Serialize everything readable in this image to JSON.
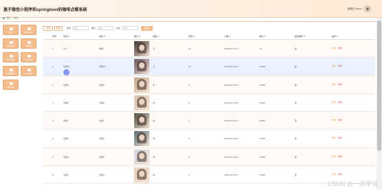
{
  "app": {
    "title": "基于微信小程序和springboot的咖啡点餐系统",
    "user_label": "管理员 admin"
  },
  "breadcrumb": {
    "items": [
      "首页",
      "咖啡"
    ]
  },
  "sidebar": {
    "items": [
      {
        "label": "首页"
      },
      {
        "label": "咖啡分类"
      },
      {
        "label": "咖啡管理"
      },
      {
        "label": "订单管理"
      },
      {
        "label": "用户管理"
      },
      {
        "label": "公告信息"
      },
      {
        "label": "轮播图管理"
      },
      {
        "label": "评论管理"
      },
      {
        "label": "系统管理"
      }
    ]
  },
  "toolbar": {
    "add_label": "+ 新增",
    "delete_label": "删除",
    "search_label": "查询"
  },
  "filters": [
    {
      "label": "名称",
      "placeholder": "名称"
    },
    {
      "label": "类别",
      "placeholder": "类别"
    },
    {
      "label": "价格",
      "placeholder": "价格"
    }
  ],
  "table": {
    "headers": [
      "序号",
      "名称 ⇕",
      "类别 ⇕",
      "图片 ⇕",
      "规格 ⇕",
      "库存 ⇕",
      "日期 ⇕",
      "单价 ⇕",
      "是否推荐 ⇕",
      "操作 ⇕"
    ],
    "rows": [
      {
        "index": "1",
        "name": "123",
        "category": "咖啡",
        "spec": "大",
        "stock": "10",
        "date": "2023-02-12 0:0",
        "price": "10",
        "recommend": "是",
        "edit": "修改",
        "delete": "删除"
      },
      {
        "index": "2",
        "name": "拿铁10",
        "category": "拿铁10",
        "spec": "大",
        "stock": "10",
        "date": "2023-02-12 0:0",
        "price": "10000",
        "recommend": "是",
        "edit": "修改",
        "delete": "删除"
      },
      {
        "index": "3",
        "name": "拿铁9",
        "category": "拿铁9",
        "spec": "中",
        "stock": "9",
        "date": "2023-02-12 0:0",
        "price": "10000",
        "recommend": "否",
        "edit": "修改",
        "delete": "删除"
      },
      {
        "index": "4",
        "name": "拿铁8",
        "category": "拿铁8",
        "spec": "中",
        "stock": "8",
        "date": "2023-02-12 0:0",
        "price": "10000",
        "recommend": "否",
        "edit": "修改",
        "delete": "删除"
      },
      {
        "index": "5",
        "name": "拿铁7",
        "category": "拿铁7",
        "spec": "中",
        "stock": "7",
        "date": "2023-02-12 0:0",
        "price": "10000",
        "recommend": "否",
        "edit": "修改",
        "delete": "删除"
      },
      {
        "index": "6",
        "name": "拿铁6",
        "category": "拿铁6",
        "spec": "中",
        "stock": "6",
        "date": "2023-02-12 0:0",
        "price": "10000",
        "recommend": "否",
        "edit": "修改",
        "delete": "删除"
      },
      {
        "index": "7",
        "name": "拿铁5",
        "category": "拿铁5",
        "spec": "中",
        "stock": "5",
        "date": "2023-02-12 0:0",
        "price": "10000",
        "recommend": "否",
        "edit": "修改",
        "delete": "删除"
      },
      {
        "index": "8",
        "name": "拿铁4",
        "category": "拿铁4",
        "spec": "中",
        "stock": "4",
        "date": "2023-02-12 0:0",
        "price": "10000",
        "recommend": "否",
        "edit": "修改",
        "delete": "删除"
      }
    ]
  },
  "watermark": "CSDN @一点毕设",
  "colors": {
    "accent": "#f3bd8d",
    "accent_dark": "#c77a3a",
    "danger": "#e06b6b",
    "selected_row": "#eaf1ff"
  },
  "icons": {
    "avatar": "avatar-icon",
    "home": "home-icon",
    "menu_tile": "menu-tile-icon"
  }
}
